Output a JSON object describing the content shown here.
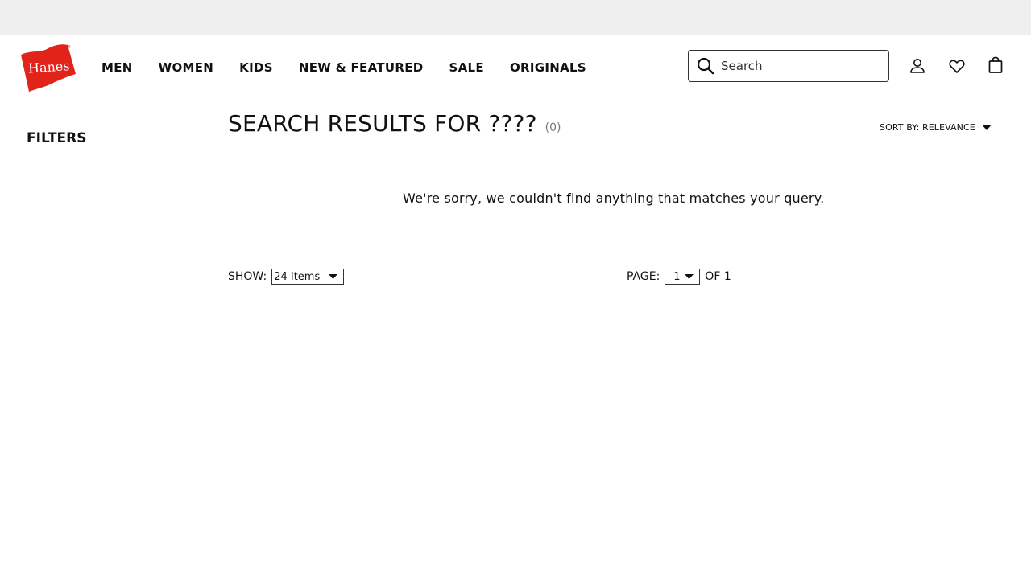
{
  "brand": {
    "logo_text": "Hanes",
    "accent_color": "#e2231a"
  },
  "nav": {
    "items": [
      "MEN",
      "WOMEN",
      "KIDS",
      "NEW & FEATURED",
      "SALE",
      "ORIGINALS"
    ]
  },
  "search": {
    "placeholder": "Search",
    "value": "",
    "icon": "search-icon"
  },
  "header_icons": {
    "account": "account-icon",
    "wishlist": "heart-icon",
    "cart": "bag-icon"
  },
  "sidebar": {
    "filters_label": "FILTERS"
  },
  "results": {
    "title": "SEARCH RESULTS FOR ????",
    "count": "(0)",
    "sort_label": "SORT BY: RELEVANCE",
    "empty_message": "We're sorry, we couldn't find anything that matches your query."
  },
  "pagination": {
    "show_label": "SHOW:",
    "show_value": "24 Items",
    "page_label": "PAGE:",
    "page_value": "1",
    "of_text": "OF 1"
  }
}
